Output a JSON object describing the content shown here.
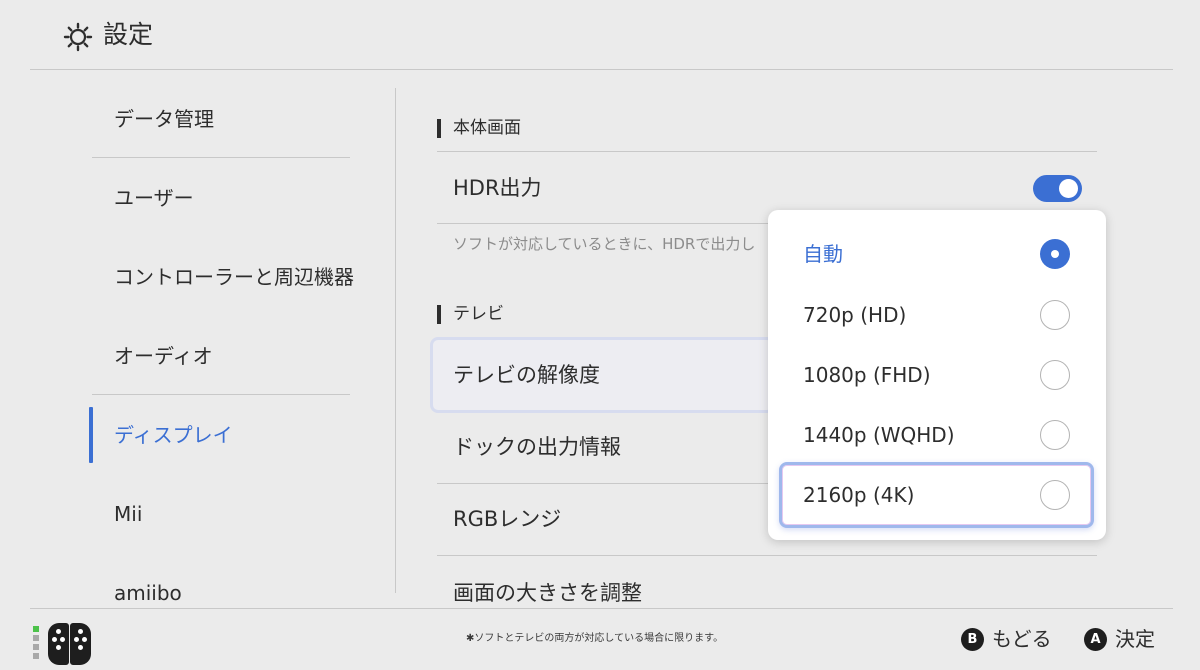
{
  "header": {
    "title": "設定",
    "icon": "gear-icon"
  },
  "sidebar": {
    "items": [
      {
        "label": "データ管理"
      },
      {
        "label": "ユーザー"
      },
      {
        "label": "コントローラーと周辺機器"
      },
      {
        "label": "オーディオ"
      },
      {
        "label": "ディスプレイ",
        "active": true
      },
      {
        "label": "Mii"
      },
      {
        "label": "amiibo"
      }
    ]
  },
  "main": {
    "sections": [
      {
        "title": "本体画面"
      },
      {
        "title": "テレビ"
      }
    ],
    "hdr": {
      "label": "HDR出力",
      "enabled": true,
      "hint": "ソフトが対応しているときに、HDRで出力し"
    },
    "rows": [
      {
        "label": "テレビの解像度"
      },
      {
        "label": "ドックの出力情報"
      },
      {
        "label": "RGBレンジ"
      },
      {
        "label": "画面の大きさを調整"
      }
    ]
  },
  "resolution_popup": {
    "options": [
      {
        "label": "自動",
        "selected": true
      },
      {
        "label": "720p (HD)",
        "selected": false
      },
      {
        "label": "1080p (FHD)",
        "selected": false
      },
      {
        "label": "1440p (WQHD)",
        "selected": false
      },
      {
        "label": "2160p (4K)",
        "selected": false,
        "focused": true
      }
    ]
  },
  "footer": {
    "note": "✱ソフトとテレビの両方が対応している場合に限ります。",
    "back": {
      "button": "B",
      "label": "もどる"
    },
    "confirm": {
      "button": "A",
      "label": "決定"
    }
  },
  "colors": {
    "accent": "#3b6fd3",
    "background": "#ebebeb"
  }
}
